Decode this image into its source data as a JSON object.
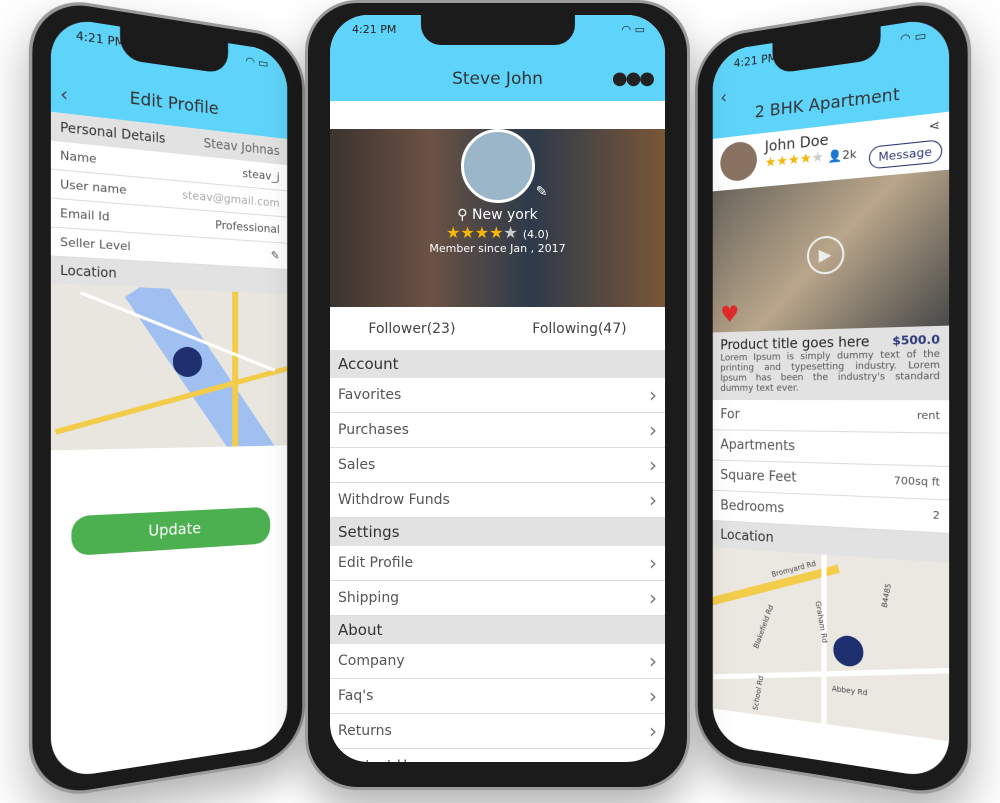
{
  "left": {
    "time": "4:21 PM",
    "title": "Edit Profile",
    "section": "Personal Details",
    "fields": [
      {
        "label": "Name",
        "value": "Steav Johnas"
      },
      {
        "label": "User name",
        "value": "steav_j"
      },
      {
        "label": "Email Id",
        "value": "steav@gmail.com"
      },
      {
        "label": "Seller Level",
        "value": "Professional"
      }
    ],
    "location_label": "Location",
    "update_label": "Update",
    "update_color": "#4cb050"
  },
  "center": {
    "time": "4:21 PM",
    "title": "Steve John",
    "location": "New york",
    "rating": 4,
    "rating_text": "(4.0)",
    "member_since": "Member since Jan , 2017",
    "follower": "Follower(23)",
    "following": "Following(47)",
    "sections": [
      {
        "title": "Account",
        "items": [
          "Favorites",
          "Purchases",
          "Sales",
          "Withdrow Funds"
        ]
      },
      {
        "title": "Settings",
        "items": [
          "Edit Profile",
          "Shipping"
        ]
      },
      {
        "title": "About",
        "items": [
          "Company",
          "Faq's",
          "Returns",
          "Contact Us"
        ]
      }
    ],
    "header_color": "#5fd4fb"
  },
  "right": {
    "time": "4:21 PM",
    "title": "2 BHK  Apartment",
    "seller": "John Doe",
    "rating": 4,
    "followers": "2k",
    "message_label": "Message",
    "product_title": "Product title goes here",
    "price": "$500.0",
    "description": "Lorem Ipsum is simply dummy text of the printing and typesetting industry. Lorem Ipsum has been the industry's standard dummy text ever.",
    "details": [
      {
        "label": "For",
        "value": "rent"
      },
      {
        "label": "Apartments",
        "value": ""
      },
      {
        "label": "Square Feet",
        "value": "700sq ft"
      },
      {
        "label": "Bedrooms",
        "value": "2"
      }
    ],
    "location_label": "Location",
    "map_labels": [
      "Bromyard Rd",
      "Blakefield Rd",
      "Graham Rd",
      "B4485",
      "Abbey Rd",
      "School Rd"
    ]
  }
}
